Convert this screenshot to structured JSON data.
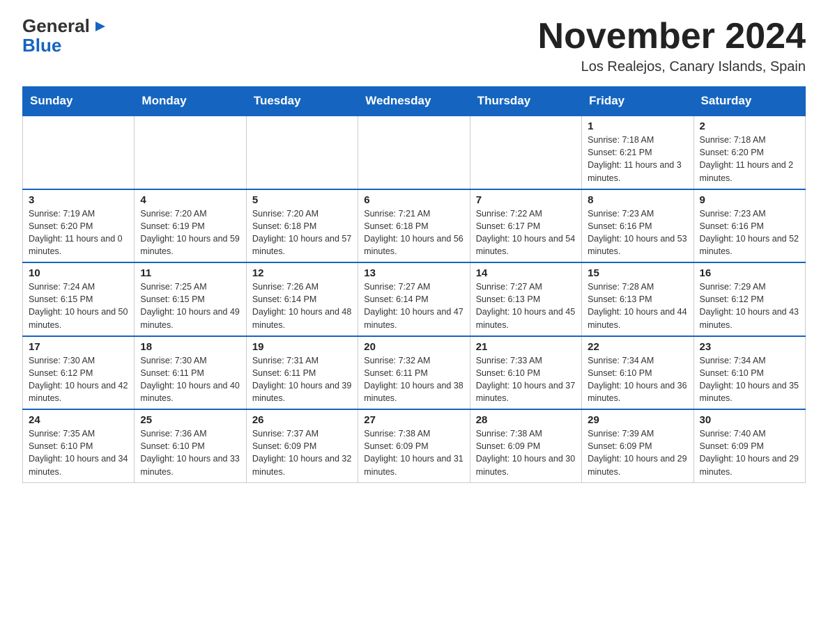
{
  "logo": {
    "part1": "General",
    "arrow": "▶",
    "part2": "Blue"
  },
  "title": "November 2024",
  "location": "Los Realejos, Canary Islands, Spain",
  "weekdays": [
    "Sunday",
    "Monday",
    "Tuesday",
    "Wednesday",
    "Thursday",
    "Friday",
    "Saturday"
  ],
  "rows": [
    [
      {
        "day": "",
        "info": ""
      },
      {
        "day": "",
        "info": ""
      },
      {
        "day": "",
        "info": ""
      },
      {
        "day": "",
        "info": ""
      },
      {
        "day": "",
        "info": ""
      },
      {
        "day": "1",
        "info": "Sunrise: 7:18 AM\nSunset: 6:21 PM\nDaylight: 11 hours and 3 minutes."
      },
      {
        "day": "2",
        "info": "Sunrise: 7:18 AM\nSunset: 6:20 PM\nDaylight: 11 hours and 2 minutes."
      }
    ],
    [
      {
        "day": "3",
        "info": "Sunrise: 7:19 AM\nSunset: 6:20 PM\nDaylight: 11 hours and 0 minutes."
      },
      {
        "day": "4",
        "info": "Sunrise: 7:20 AM\nSunset: 6:19 PM\nDaylight: 10 hours and 59 minutes."
      },
      {
        "day": "5",
        "info": "Sunrise: 7:20 AM\nSunset: 6:18 PM\nDaylight: 10 hours and 57 minutes."
      },
      {
        "day": "6",
        "info": "Sunrise: 7:21 AM\nSunset: 6:18 PM\nDaylight: 10 hours and 56 minutes."
      },
      {
        "day": "7",
        "info": "Sunrise: 7:22 AM\nSunset: 6:17 PM\nDaylight: 10 hours and 54 minutes."
      },
      {
        "day": "8",
        "info": "Sunrise: 7:23 AM\nSunset: 6:16 PM\nDaylight: 10 hours and 53 minutes."
      },
      {
        "day": "9",
        "info": "Sunrise: 7:23 AM\nSunset: 6:16 PM\nDaylight: 10 hours and 52 minutes."
      }
    ],
    [
      {
        "day": "10",
        "info": "Sunrise: 7:24 AM\nSunset: 6:15 PM\nDaylight: 10 hours and 50 minutes."
      },
      {
        "day": "11",
        "info": "Sunrise: 7:25 AM\nSunset: 6:15 PM\nDaylight: 10 hours and 49 minutes."
      },
      {
        "day": "12",
        "info": "Sunrise: 7:26 AM\nSunset: 6:14 PM\nDaylight: 10 hours and 48 minutes."
      },
      {
        "day": "13",
        "info": "Sunrise: 7:27 AM\nSunset: 6:14 PM\nDaylight: 10 hours and 47 minutes."
      },
      {
        "day": "14",
        "info": "Sunrise: 7:27 AM\nSunset: 6:13 PM\nDaylight: 10 hours and 45 minutes."
      },
      {
        "day": "15",
        "info": "Sunrise: 7:28 AM\nSunset: 6:13 PM\nDaylight: 10 hours and 44 minutes."
      },
      {
        "day": "16",
        "info": "Sunrise: 7:29 AM\nSunset: 6:12 PM\nDaylight: 10 hours and 43 minutes."
      }
    ],
    [
      {
        "day": "17",
        "info": "Sunrise: 7:30 AM\nSunset: 6:12 PM\nDaylight: 10 hours and 42 minutes."
      },
      {
        "day": "18",
        "info": "Sunrise: 7:30 AM\nSunset: 6:11 PM\nDaylight: 10 hours and 40 minutes."
      },
      {
        "day": "19",
        "info": "Sunrise: 7:31 AM\nSunset: 6:11 PM\nDaylight: 10 hours and 39 minutes."
      },
      {
        "day": "20",
        "info": "Sunrise: 7:32 AM\nSunset: 6:11 PM\nDaylight: 10 hours and 38 minutes."
      },
      {
        "day": "21",
        "info": "Sunrise: 7:33 AM\nSunset: 6:10 PM\nDaylight: 10 hours and 37 minutes."
      },
      {
        "day": "22",
        "info": "Sunrise: 7:34 AM\nSunset: 6:10 PM\nDaylight: 10 hours and 36 minutes."
      },
      {
        "day": "23",
        "info": "Sunrise: 7:34 AM\nSunset: 6:10 PM\nDaylight: 10 hours and 35 minutes."
      }
    ],
    [
      {
        "day": "24",
        "info": "Sunrise: 7:35 AM\nSunset: 6:10 PM\nDaylight: 10 hours and 34 minutes."
      },
      {
        "day": "25",
        "info": "Sunrise: 7:36 AM\nSunset: 6:10 PM\nDaylight: 10 hours and 33 minutes."
      },
      {
        "day": "26",
        "info": "Sunrise: 7:37 AM\nSunset: 6:09 PM\nDaylight: 10 hours and 32 minutes."
      },
      {
        "day": "27",
        "info": "Sunrise: 7:38 AM\nSunset: 6:09 PM\nDaylight: 10 hours and 31 minutes."
      },
      {
        "day": "28",
        "info": "Sunrise: 7:38 AM\nSunset: 6:09 PM\nDaylight: 10 hours and 30 minutes."
      },
      {
        "day": "29",
        "info": "Sunrise: 7:39 AM\nSunset: 6:09 PM\nDaylight: 10 hours and 29 minutes."
      },
      {
        "day": "30",
        "info": "Sunrise: 7:40 AM\nSunset: 6:09 PM\nDaylight: 10 hours and 29 minutes."
      }
    ]
  ]
}
